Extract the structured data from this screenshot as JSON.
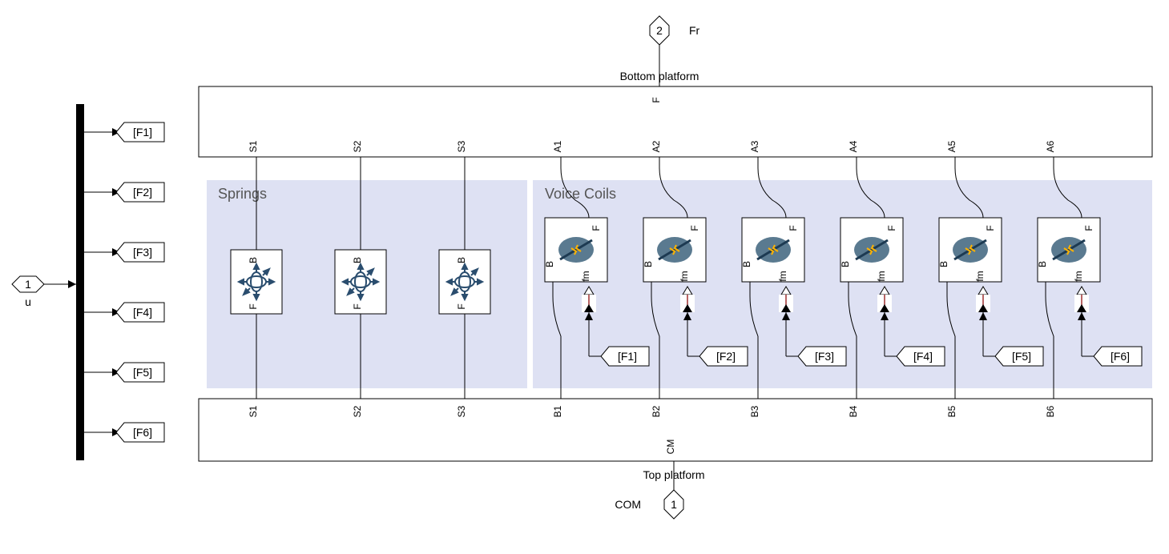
{
  "input_port": {
    "num": "1",
    "name": "u"
  },
  "top_hex": {
    "num": "2",
    "label": "Fr"
  },
  "bottom_platform": {
    "name": "Bottom platform",
    "port_top": "F"
  },
  "top_platform": {
    "name": "Top platform",
    "port_bottom": "CM"
  },
  "bottom_out": {
    "label": "COM",
    "num": "1"
  },
  "demux_tags": [
    "[F1]",
    "[F2]",
    "[F3]",
    "[F4]",
    "[F5]",
    "[F6]"
  ],
  "springs_group": {
    "title": "Springs",
    "items": [
      {
        "top": "S1",
        "bottom": "S1",
        "B": "B",
        "F": "F"
      },
      {
        "top": "S2",
        "bottom": "S2",
        "B": "B",
        "F": "F"
      },
      {
        "top": "S3",
        "bottom": "S3",
        "B": "B",
        "F": "F"
      }
    ]
  },
  "voicecoils_group": {
    "title": "Voice Coils",
    "items": [
      {
        "top": "A1",
        "bottom": "B1",
        "B": "B",
        "F": "F",
        "fm": "fm",
        "tag": "[F1]"
      },
      {
        "top": "A2",
        "bottom": "B2",
        "B": "B",
        "F": "F",
        "fm": "fm",
        "tag": "[F2]"
      },
      {
        "top": "A3",
        "bottom": "B3",
        "B": "B",
        "F": "F",
        "fm": "fm",
        "tag": "[F3]"
      },
      {
        "top": "A4",
        "bottom": "B4",
        "B": "B",
        "F": "F",
        "fm": "fm",
        "tag": "[F4]"
      },
      {
        "top": "A5",
        "bottom": "B5",
        "B": "B",
        "F": "F",
        "fm": "fm",
        "tag": "[F5]"
      },
      {
        "top": "A6",
        "bottom": "B6",
        "B": "B",
        "F": "F",
        "fm": "fm",
        "tag": "[F6]"
      }
    ]
  }
}
